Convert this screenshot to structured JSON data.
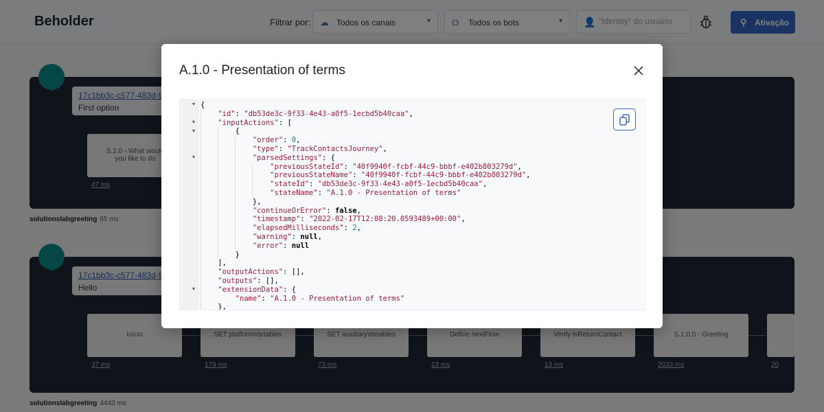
{
  "header": {
    "brand": "Beholder",
    "filter_label": "Filtrar por:",
    "channels_select": {
      "value": "Todos os canais",
      "icon": "cloud-icon"
    },
    "bots_select": {
      "value": "Todos os bots",
      "icon": "bot-icon"
    },
    "identity_input": {
      "placeholder": "\"Identity\" do usuário",
      "value": ""
    },
    "activate_button": {
      "label": "Ativação",
      "icon": "sitemap-icon"
    }
  },
  "background": {
    "panel1": {
      "message_id": "17c1bb3c-c577-483d-9",
      "message": "First option",
      "state_label": "S.2.0 - What would you like to do",
      "state_duration": "47 ms",
      "footer_name": "solutionslabgreeting",
      "footer_ms": "65 ms"
    },
    "panel2": {
      "message_id": "17c1bb3c-c577-483d-9",
      "message": "Hello",
      "states": [
        {
          "label": "Início",
          "duration": "37 ms"
        },
        {
          "label": "SET platformVariables",
          "duration": "179 ms"
        },
        {
          "label": "SET auxiliaryVariables",
          "duration": "73 ms"
        },
        {
          "label": "Define nextFlow",
          "duration": "13 ms"
        },
        {
          "label": "Verify isReturnContact",
          "duration": "13 ms"
        },
        {
          "label": "S.1.0.0 - Greeting",
          "duration": "2033 ms"
        }
      ],
      "truncated_duration": "20",
      "footer_name": "solutionslabgreeting",
      "footer_ms": "4443 ms"
    }
  },
  "modal": {
    "title": "A.1.0 - Presentation of terms",
    "close_icon": "close-icon",
    "copy_icon": "copy-icon",
    "json": {
      "id": "db53de3c-9f33-4e43-a0f5-1ecbd5b40caa",
      "order": "0",
      "type": "TrackContactsJourney",
      "previousStateId": "40f9940f-fcbf-44c9-bbbf-e402b803279d",
      "previousStateName": "40f9940f-fcbf-44c9-bbbf-e402b803279d",
      "stateId": "db53de3c-9f33-4e43-a0f5-1ecbd5b40caa",
      "stateName": "A.1.0 - Presentation of terms",
      "continueOrError": "false",
      "timestamp": "2022-02-17T12:08:20.0593489+00:00",
      "elapsedMilliseconds": "2",
      "warning": "null",
      "error": "null",
      "extensionData_name": "A.1.0 - Presentation of terms"
    }
  }
}
